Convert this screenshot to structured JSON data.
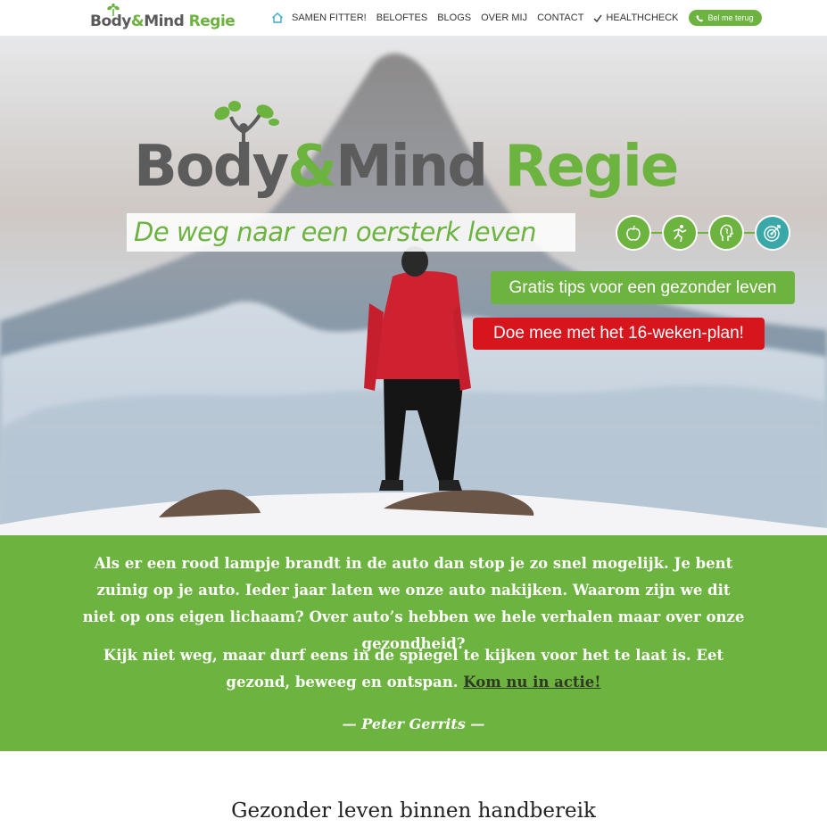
{
  "header": {
    "logo": {
      "body": "Body",
      "amp": "&",
      "mind": "Mind",
      "regie": " Regie"
    },
    "nav": [
      {
        "label": "Samen fitter!"
      },
      {
        "label": "Beloftes"
      },
      {
        "label": "Blogs"
      },
      {
        "label": "Over mij"
      },
      {
        "label": "Contact"
      },
      {
        "label": "Healthcheck"
      }
    ],
    "call_button": "Bel me terug"
  },
  "hero": {
    "logo": {
      "body": "Body",
      "amp": "&",
      "mind": "Mind",
      "regie": " Regie"
    },
    "tagline": "De weg naar een oersterk leven",
    "icons": [
      "apple-icon",
      "runner-icon",
      "brain-icon",
      "target-icon"
    ],
    "cta_green": "Gratis tips voor een gezonder leven",
    "cta_red": "Doe mee met het 16-weken-plan!"
  },
  "quote": {
    "p1": "Als er een rood lampje brandt in de auto dan stop je zo snel mogelijk. Je bent zuinig op je auto. Ieder jaar laten we onze auto nakijken. Waarom zijn we dit niet op ons eigen lichaam? Over auto’s hebben we hele verhalen maar over onze gezondheid?",
    "p2_text": "Kijk niet weg, maar durf eens in de spiegel te kijken voor het te laat is. Eet gezond, beweeg en ontspan. ",
    "p2_link": "Kom nu in actie!",
    "author": "— Peter Gerrits —"
  },
  "section": {
    "title": "Gezonder leven binnen handbereik"
  },
  "colors": {
    "brand_green": "#6cb33f",
    "brand_red": "#d7151d",
    "teal": "#3aa8a8",
    "logo_gray": "#5c5c5c"
  }
}
